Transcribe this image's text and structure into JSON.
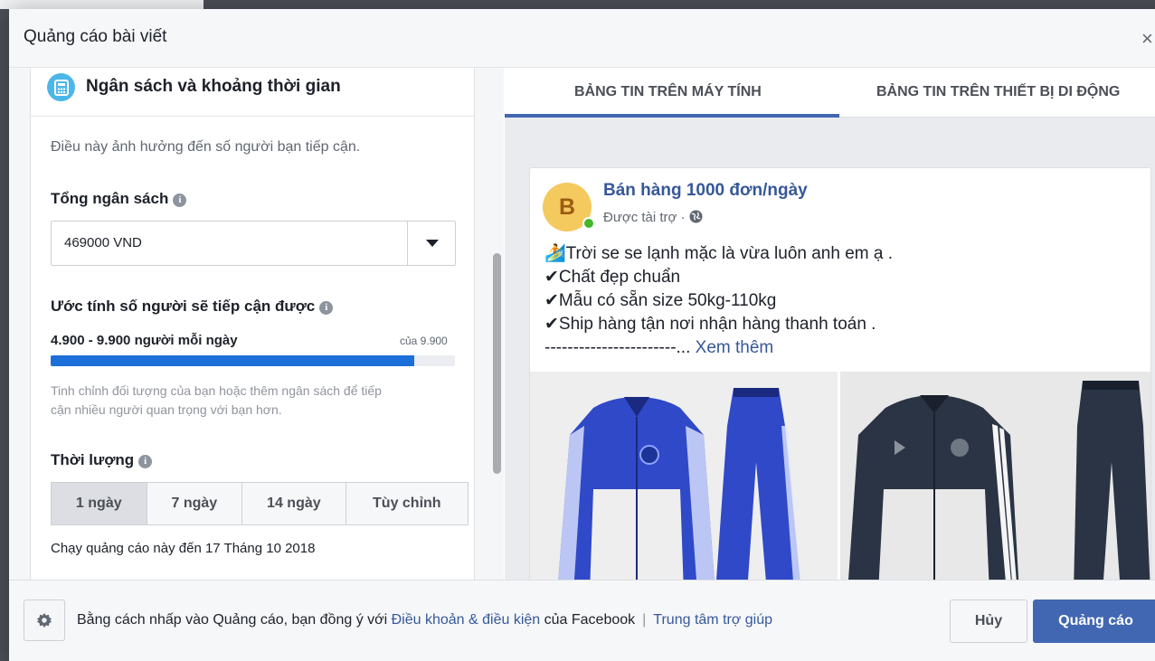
{
  "dialog": {
    "title": "Quảng cáo bài viết",
    "close_label": "×"
  },
  "budget_card": {
    "title": "Ngân sách và khoảng thời gian",
    "intro": "Điều này ảnh hưởng đến số người bạn tiếp cận.",
    "total_budget_label": "Tổng ngân sách",
    "budget_value": "469000 VND",
    "estimate_label": "Ước tính số người sẽ tiếp cận được",
    "estimate_range": "4.900 - 9.900 người mỗi ngày",
    "estimate_of": "của 9.900",
    "estimate_fraction": 0.9,
    "hint_line1": "Tinh chỉnh đối tượng của bạn hoặc thêm ngân sách để tiếp",
    "hint_line2": "cận nhiều người quan trọng với bạn hơn.",
    "duration_label": "Thời lượng",
    "durations": [
      "1 ngày",
      "7 ngày",
      "14 ngày",
      "Tùy chỉnh"
    ],
    "selected_duration": "1 ngày",
    "run_until": "Chạy quảng cáo này đến 17 Tháng 10 2018"
  },
  "preview": {
    "tabs": [
      "BẢNG TIN TRÊN MÁY TÍNH",
      "BẢNG TIN TRÊN THIẾT BỊ DI ĐỘNG"
    ],
    "active_tab": "BẢNG TIN TRÊN MÁY TÍNH",
    "post": {
      "avatar_letter": "B",
      "page_name": "Bán hàng 1000 đơn/ngày",
      "sponsored": "Được tài trợ · ",
      "lines": [
        "🏄Trời se se lạnh mặc là vừa luôn anh em ạ .",
        "✔Chất đẹp chuẩn",
        "✔Mẫu có sẵn size 50kg-110kg",
        "✔Ship hàng tận nơi nhận hàng thanh toán ."
      ],
      "dashes": "-----------------------... ",
      "see_more": "Xem thêm"
    }
  },
  "footer": {
    "agree_prefix": "Bằng cách nhấp vào Quảng cáo, bạn đồng ý với ",
    "terms_link": "Điều khoản & điều kiện",
    "agree_suffix": " của Facebook",
    "separator": "|",
    "help_link": "Trung tâm trợ giúp",
    "cancel": "Hủy",
    "submit": "Quảng cáo"
  },
  "colors": {
    "accent": "#4267b2",
    "progress": "#1c6fd8",
    "link": "#365899",
    "online": "#42b72a"
  }
}
